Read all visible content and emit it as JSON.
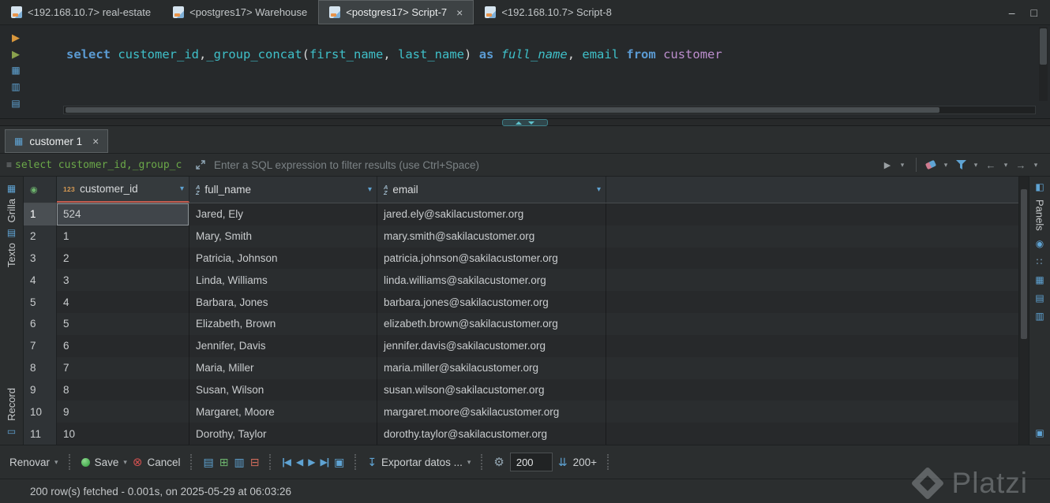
{
  "window_tabs": {
    "tabs": [
      {
        "label": "<192.168.10.7> real-estate"
      },
      {
        "label": "<postgres17> Warehouse"
      },
      {
        "label": "<postgres17> Script-7",
        "active": true
      },
      {
        "label": "<192.168.10.7> Script-8"
      }
    ]
  },
  "editor": {
    "tokens": [
      {
        "t": "select",
        "c": "keyword"
      },
      {
        "t": " ",
        "c": "plain"
      },
      {
        "t": "customer_id",
        "c": "ident"
      },
      {
        "t": ",",
        "c": "plain"
      },
      {
        "t": "_group_concat",
        "c": "ident"
      },
      {
        "t": "(",
        "c": "plain"
      },
      {
        "t": "first_name",
        "c": "ident"
      },
      {
        "t": ", ",
        "c": "plain"
      },
      {
        "t": "last_name",
        "c": "ident"
      },
      {
        "t": ") ",
        "c": "plain"
      },
      {
        "t": "as",
        "c": "keyword"
      },
      {
        "t": " ",
        "c": "plain"
      },
      {
        "t": "full_name",
        "c": "alias"
      },
      {
        "t": ", ",
        "c": "plain"
      },
      {
        "t": "email",
        "c": "ident"
      },
      {
        "t": " ",
        "c": "plain"
      },
      {
        "t": "from",
        "c": "keyword"
      },
      {
        "t": " ",
        "c": "plain"
      },
      {
        "t": "customer",
        "c": "table"
      }
    ]
  },
  "results": {
    "tab_label": "customer 1",
    "filter_query_preview": "select customer_id,_group_c",
    "filter_placeholder": "Enter a SQL expression to filter results (use Ctrl+Space)",
    "side_tab_grid": "Grilla",
    "side_tab_text": "Texto",
    "record_label": "Record",
    "panels_label": "Panels"
  },
  "grid": {
    "columns": [
      {
        "name": "customer_id",
        "type": "numeric"
      },
      {
        "name": "full_name",
        "type": "text"
      },
      {
        "name": "email",
        "type": "text"
      }
    ],
    "rows": [
      {
        "num": "1",
        "customer_id": "524",
        "full_name": "Jared, Ely",
        "email": "jared.ely@sakilacustomer.org"
      },
      {
        "num": "2",
        "customer_id": "1",
        "full_name": "Mary, Smith",
        "email": "mary.smith@sakilacustomer.org"
      },
      {
        "num": "3",
        "customer_id": "2",
        "full_name": "Patricia, Johnson",
        "email": "patricia.johnson@sakilacustomer.org"
      },
      {
        "num": "4",
        "customer_id": "3",
        "full_name": "Linda, Williams",
        "email": "linda.williams@sakilacustomer.org"
      },
      {
        "num": "5",
        "customer_id": "4",
        "full_name": "Barbara, Jones",
        "email": "barbara.jones@sakilacustomer.org"
      },
      {
        "num": "6",
        "customer_id": "5",
        "full_name": "Elizabeth, Brown",
        "email": "elizabeth.brown@sakilacustomer.org"
      },
      {
        "num": "7",
        "customer_id": "6",
        "full_name": "Jennifer, Davis",
        "email": "jennifer.davis@sakilacustomer.org"
      },
      {
        "num": "8",
        "customer_id": "7",
        "full_name": "Maria, Miller",
        "email": "maria.miller@sakilacustomer.org"
      },
      {
        "num": "9",
        "customer_id": "8",
        "full_name": "Susan, Wilson",
        "email": "susan.wilson@sakilacustomer.org"
      },
      {
        "num": "10",
        "customer_id": "9",
        "full_name": "Margaret, Moore",
        "email": "margaret.moore@sakilacustomer.org"
      },
      {
        "num": "11",
        "customer_id": "10",
        "full_name": "Dorothy, Taylor",
        "email": "dorothy.taylor@sakilacustomer.org"
      }
    ]
  },
  "toolbar": {
    "refresh_label": "Renovar",
    "save_label": "Save",
    "cancel_label": "Cancel",
    "export_label": "Exportar datos ...",
    "fetch_size_value": "200",
    "fetch_more_label": "200+"
  },
  "status_bar": {
    "message": "200 row(s) fetched - 0.001s, on 2025-05-29 at 06:03:26"
  },
  "watermark": {
    "brand": "Platzi"
  },
  "colors": {
    "accent_blue": "#5fa3d3",
    "keyword_blue": "#5b9bd3",
    "identifier_teal": "#3fc0c9",
    "table_purple": "#bd8ece",
    "filter_green": "#6ba849",
    "selected_column_accent": "#c25b4e",
    "save_green": "#2e9e3a",
    "cancel_red": "#cf5050"
  }
}
